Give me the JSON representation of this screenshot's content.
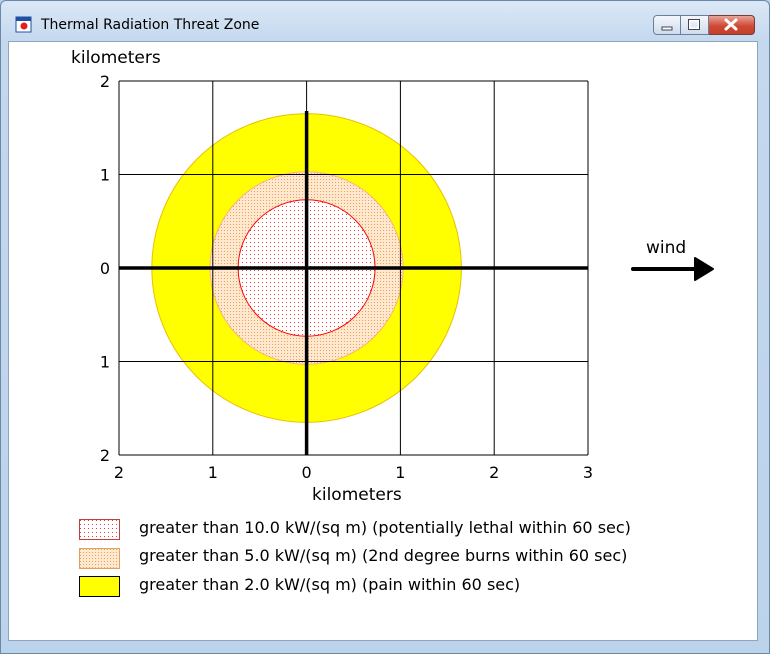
{
  "window": {
    "title": "Thermal Radiation Threat Zone",
    "controls": [
      "minimize",
      "maximize",
      "close"
    ]
  },
  "plot": {
    "y_axis_label": "kilometers",
    "x_axis_label": "kilometers",
    "y_ticks": [
      "2",
      "1",
      "0",
      "1",
      "2"
    ],
    "x_ticks": [
      "2",
      "1",
      "0",
      "1",
      "2",
      "3"
    ],
    "wind_label": "wind"
  },
  "chart_data": {
    "type": "threat-zone",
    "units": "kilometers",
    "xlim": [
      -2,
      3
    ],
    "ylim": [
      -2,
      2
    ],
    "grid": true,
    "zones": [
      {
        "radius_km": 1.65,
        "color": "#ffff00",
        "pattern": "solid",
        "level": "greater than 2.0 kW/(sq m)"
      },
      {
        "radius_km": 1.03,
        "color": "#ffddbb",
        "pattern": "orange dots",
        "level": "greater than 5.0 kW/(sq m)"
      },
      {
        "radius_km": 0.73,
        "color": "#fff0f0",
        "pattern": "red dots",
        "level": "greater than 10.0 kW/(sq m)"
      }
    ]
  },
  "legend": [
    {
      "label": "greater than 10.0 kW/(sq m) (potentially lethal within 60 sec)",
      "style": "red-dots"
    },
    {
      "label": "greater than 5.0 kW/(sq m) (2nd degree burns within 60 sec)",
      "style": "orange-dots"
    },
    {
      "label": "greater than 2.0 kW/(sq m) (pain within 60 sec)",
      "style": "yellow"
    }
  ],
  "colors": {
    "yellow": "#ffff00",
    "orange_fill": "#ffe0c0",
    "orange_dot": "#f0a050",
    "red_dot": "#e04040",
    "red_line": "#ff0000",
    "window_frame": "#b9d1ea"
  }
}
